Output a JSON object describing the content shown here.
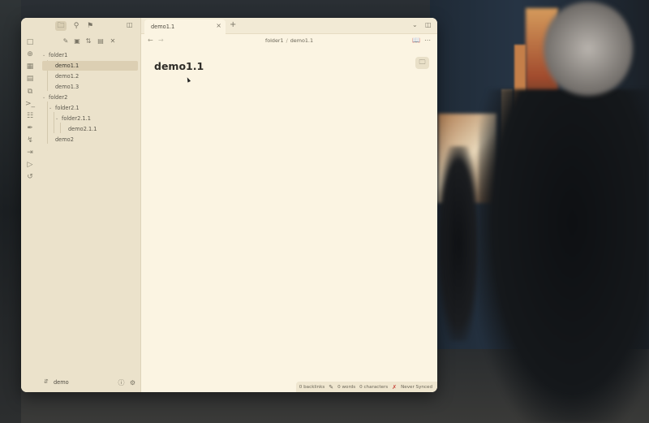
{
  "tab": {
    "title": "demo1.1"
  },
  "breadcrumb": {
    "parent": "folder1",
    "separator": "/",
    "current": "demo1.1"
  },
  "document": {
    "title": "demo1.1"
  },
  "tree": {
    "folder1": "folder1",
    "demo1_1": "demo1.1",
    "demo1_2": "demo1.2",
    "demo1_3": "demo1.3",
    "folder2": "folder2",
    "folder2_1": "folder2.1",
    "folder2_1_1": "folder2.1.1",
    "demo2_1_1": "demo2.1.1",
    "demo2": "demo2"
  },
  "vault": {
    "name": "demo"
  },
  "status": {
    "backlinks": "0 backlinks",
    "words": "0 words",
    "characters": "0 characters",
    "sync": "Never Synced"
  },
  "icons": {
    "ribbon": [
      "new-note-icon",
      "graph-icon",
      "canvas-icon",
      "calendar-icon",
      "copy-icon",
      "terminal-icon",
      "kanban-icon",
      "brush-icon",
      "bolt-icon",
      "export-icon",
      "slides-icon",
      "history-icon"
    ],
    "sidebar_top": [
      "folder-icon",
      "search-icon",
      "bookmark-icon",
      "sidebar-toggle-icon"
    ]
  },
  "colors": {
    "pane_bg": "#fbf4e2",
    "sidebar_bg": "#ebe2cb",
    "selected_row": "#dccfb3",
    "sync_error": "#c9493e"
  }
}
